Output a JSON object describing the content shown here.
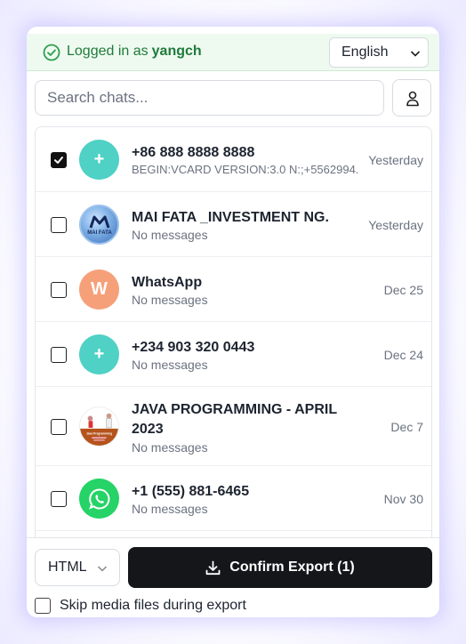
{
  "header": {
    "login_prefix": "Logged in as",
    "username": "yangch",
    "language": "English"
  },
  "search": {
    "placeholder": "Search chats..."
  },
  "chats": [
    {
      "name": "+86 888 8888 8888",
      "preview": "BEGIN:VCARD VERSION:3.0 N:;+5562994...",
      "time": "Yesterday",
      "checked": true,
      "avatar": "+",
      "avatar_color": "#4fd1c5"
    },
    {
      "name": "MAI FATA _INVESTMENT NG.",
      "preview": "No messages",
      "time": "Yesterday",
      "checked": false,
      "avatar": "MAI FATA",
      "avatar_color": "#5a8fd0"
    },
    {
      "name": "WhatsApp",
      "preview": "No messages",
      "time": "Dec 25",
      "checked": false,
      "avatar": "W",
      "avatar_color": "#f6a07a"
    },
    {
      "name": "+234 903 320 0443",
      "preview": "No messages",
      "time": "Dec 24",
      "checked": false,
      "avatar": "+",
      "avatar_color": "#4fd1c5"
    },
    {
      "name": "JAVA PROGRAMMING - APRIL 2023",
      "preview": "No messages",
      "time": "Dec 7",
      "checked": false,
      "avatar": "Java Programming",
      "avatar_color": "#b4531c"
    },
    {
      "name": "+1 (555) 881-6465",
      "preview": "No messages",
      "time": "Nov 30",
      "checked": false,
      "avatar": "whatsapp-icon",
      "avatar_color": "#25d366"
    }
  ],
  "footer": {
    "format": "HTML",
    "export_label": "Confirm Export (1)",
    "skip_label": "Skip media files during export"
  }
}
